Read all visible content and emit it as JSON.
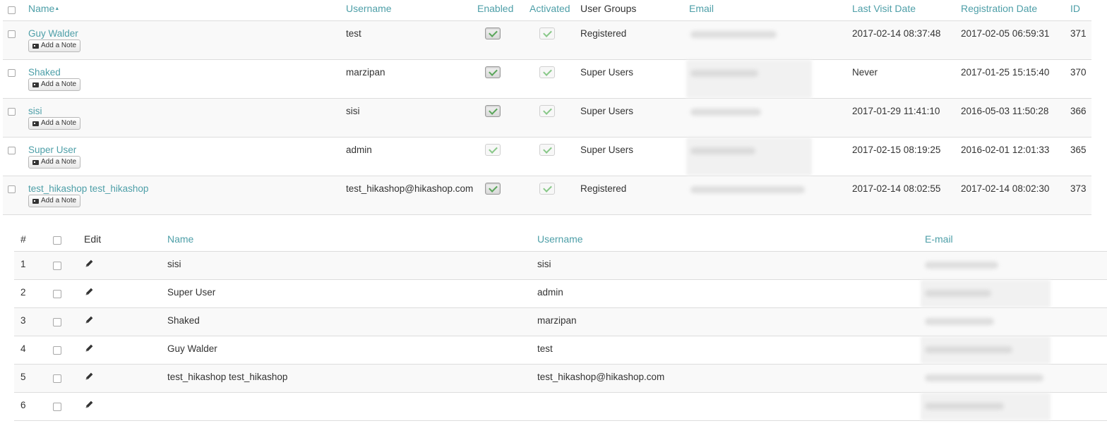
{
  "users_table": {
    "headers": {
      "name": "Name",
      "username": "Username",
      "enabled": "Enabled",
      "activated": "Activated",
      "user_groups": "User Groups",
      "email": "Email",
      "last_visit": "Last Visit Date",
      "registration": "Registration Date",
      "id": "ID"
    },
    "sort_indicator": "▲",
    "add_note_label": "Add a Note",
    "rows": [
      {
        "name": "Guy Walder",
        "username": "test",
        "enabled": true,
        "activated": true,
        "group": "Registered",
        "last_visit": "2017-02-14 08:37:48",
        "registered": "2017-02-05 06:59:31",
        "id": "371"
      },
      {
        "name": "Shaked",
        "username": "marzipan",
        "enabled": true,
        "activated": true,
        "group": "Super Users",
        "last_visit": "Never",
        "registered": "2017-01-25 15:15:40",
        "id": "370"
      },
      {
        "name": "sisi",
        "username": "sisi",
        "enabled": true,
        "activated": true,
        "group": "Super Users",
        "last_visit": "2017-01-29 11:41:10",
        "registered": "2016-05-03 11:50:28",
        "id": "366"
      },
      {
        "name": "Super User",
        "username": "admin",
        "enabled": false,
        "activated": true,
        "group": "Super Users",
        "last_visit": "2017-02-15 08:19:25",
        "registered": "2016-02-01 12:01:33",
        "id": "365"
      },
      {
        "name": "test_hikashop test_hikashop",
        "username": "test_hikashop@hikashop.com",
        "enabled": true,
        "activated": true,
        "group": "Registered",
        "last_visit": "2017-02-14 08:02:55",
        "registered": "2017-02-14 08:02:30",
        "id": "373"
      }
    ]
  },
  "customers_table": {
    "headers": {
      "num": "#",
      "edit": "Edit",
      "name": "Name",
      "username": "Username",
      "email": "E-mail"
    },
    "rows": [
      {
        "num": "1",
        "name": "sisi",
        "username": "sisi"
      },
      {
        "num": "2",
        "name": "Super User",
        "username": "admin"
      },
      {
        "num": "3",
        "name": "Shaked",
        "username": "marzipan"
      },
      {
        "num": "4",
        "name": "Guy Walder",
        "username": "test"
      },
      {
        "num": "5",
        "name": "test_hikashop test_hikashop",
        "username": "test_hikashop@hikashop.com"
      },
      {
        "num": "6",
        "name": "",
        "username": ""
      }
    ]
  },
  "colors": {
    "link": "#4e9fa8",
    "check_green": "#5aa55a",
    "row_stripe": "#f9f9f9",
    "border": "#dddddd"
  },
  "icons": [
    "sort-asc-icon",
    "note-card-icon",
    "checkmark-icon",
    "pencil-icon"
  ]
}
